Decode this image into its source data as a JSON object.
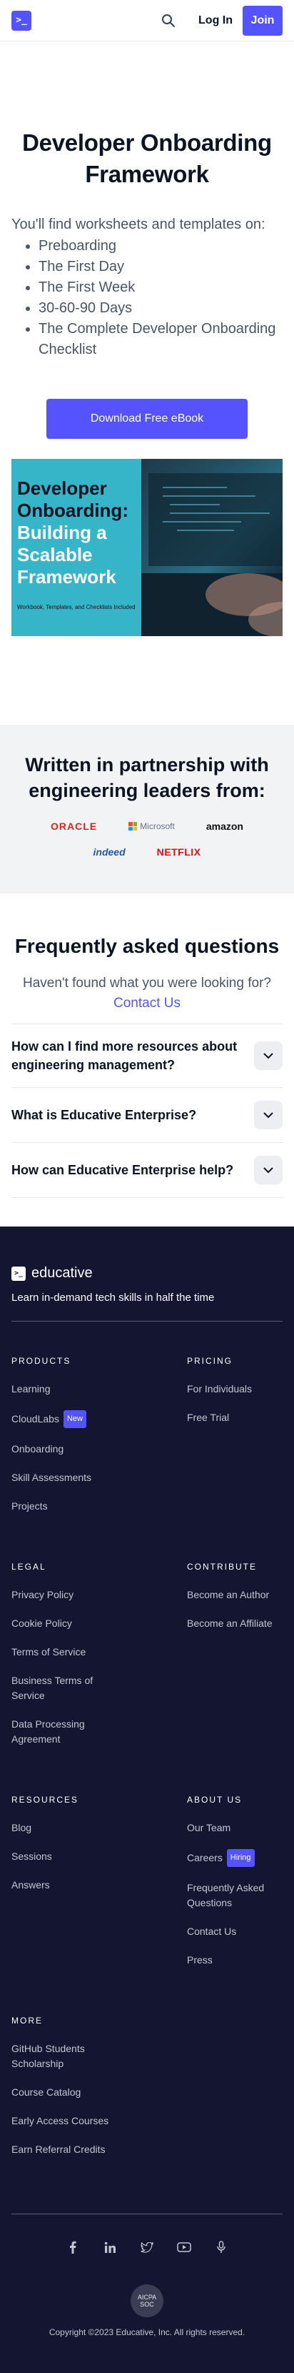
{
  "header": {
    "logo_glyph": ">_",
    "login": "Log In",
    "join": "Join",
    "accent": "#5553ff"
  },
  "hero": {
    "title": "Developer Onboarding Framework",
    "intro": "You'll find worksheets and templates on:",
    "items": [
      "Preboarding",
      "The First Day",
      "The First Week",
      "30-60-90 Days",
      "The Complete Developer Onboarding Checklist"
    ],
    "cta": "Download Free eBook",
    "ebook": {
      "line1": "Developer Onboarding:",
      "line2": "Building a Scalable Framework",
      "small": "Workbook, Templates, and Checklists Included"
    }
  },
  "partners": {
    "title": "Written in partnership with engineering leaders from:",
    "logos": [
      "ORACLE",
      "Microsoft",
      "amazon",
      "indeed",
      "NETFLIX"
    ]
  },
  "faq": {
    "title": "Frequently asked questions",
    "sub": "Haven't found what you were looking for?",
    "contact": "Contact Us",
    "items": [
      "How can I find more resources about engineering management?",
      "What is Educative Enterprise?",
      "How can Educative Enterprise help?"
    ]
  },
  "footer": {
    "brand": "educative",
    "tagline": "Learn in-demand tech skills in half the time",
    "products": {
      "heading": "PRODUCTS",
      "links": [
        "Learning",
        "CloudLabs",
        "Onboarding",
        "Skill Assessments",
        "Projects"
      ],
      "new_badge": "New"
    },
    "pricing": {
      "heading": "PRICING",
      "links": [
        "For Individuals",
        "Free Trial"
      ]
    },
    "legal": {
      "heading": "LEGAL",
      "links": [
        "Privacy Policy",
        "Cookie Policy",
        "Terms of Service",
        "Business Terms of Service",
        "Data Processing Agreement"
      ]
    },
    "contribute": {
      "heading": "CONTRIBUTE",
      "links": [
        "Become an Author",
        "Become an Affiliate"
      ]
    },
    "resources": {
      "heading": "RESOURCES",
      "links": [
        "Blog",
        "Sessions",
        "Answers"
      ]
    },
    "about": {
      "heading": "ABOUT US",
      "links": [
        "Our Team",
        "Careers",
        "Frequently Asked Questions",
        "Contact Us",
        "Press"
      ],
      "hiring_badge": "Hiring"
    },
    "more": {
      "heading": "MORE",
      "links": [
        "GitHub Students Scholarship",
        "Course Catalog",
        "Early Access Courses",
        "Earn Referral Credits"
      ]
    },
    "social_icons": [
      "facebook-icon",
      "linkedin-icon",
      "twitter-icon",
      "youtube-icon",
      "podcast-icon"
    ],
    "seal": "AICPA SOC",
    "copyright": "Copyright ©2023 Educative, Inc. All rights reserved."
  }
}
